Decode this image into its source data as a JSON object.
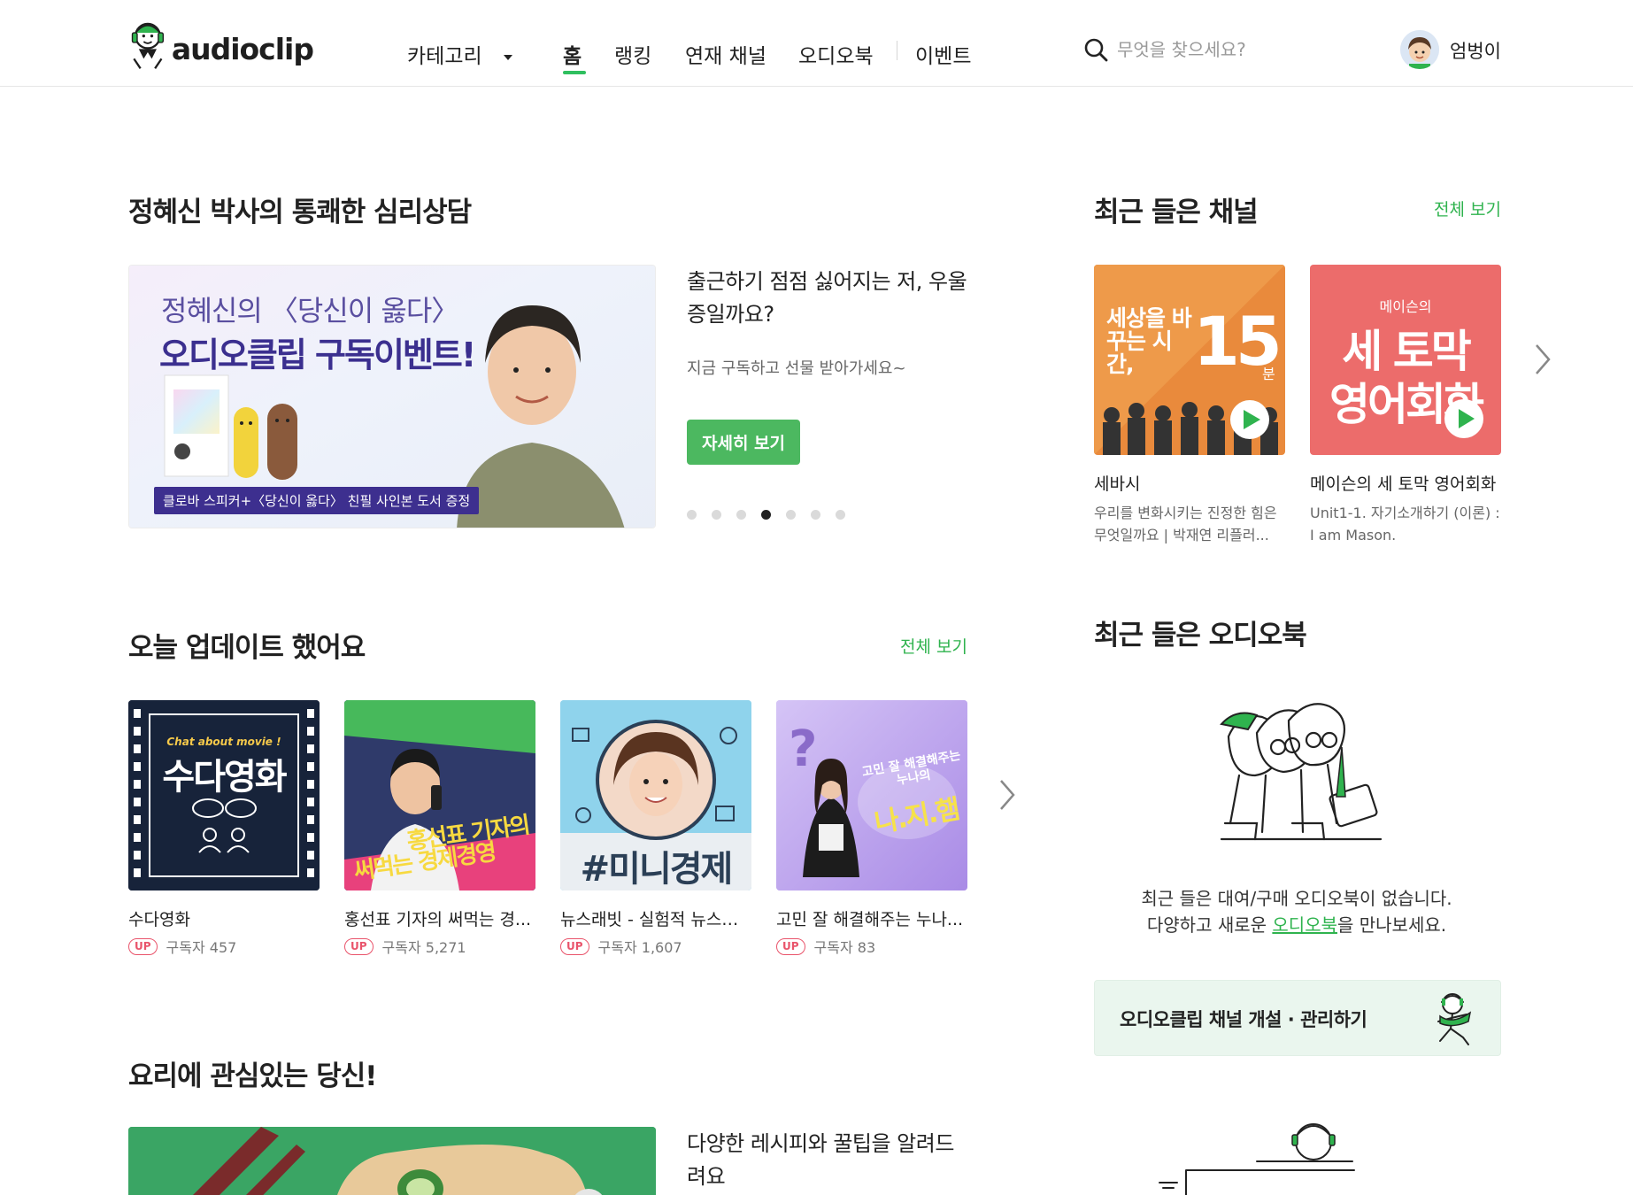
{
  "header": {
    "logo_text": "audioclip",
    "nav": {
      "category": "카테고리",
      "home": "홈",
      "ranking": "랭킹",
      "serial": "연재 채널",
      "audiobook": "오디오북",
      "event": "이벤트"
    },
    "search_placeholder": "무엇을 찾으세요?",
    "username": "엄벙이"
  },
  "feature": {
    "section_title": "정혜신 박사의 통쾌한 심리상담",
    "banner_line1": "정혜신의 〈당신이 옳다〉",
    "banner_line2": "오디오클립 구독이벤트!",
    "banner_caption": "클로바 스피커+〈당신이 옳다〉 친필 사인본 도서 증정",
    "headline": "출근하기 점점 싫어지는 저, 우울증일까요?",
    "sub": "지금 구독하고 선물 받아가세요~",
    "button": "자세히 보기",
    "dots_total": 7,
    "dots_active": 4
  },
  "recent_channels": {
    "title": "최근 들은 채널",
    "view_all": "전체 보기",
    "items": [
      {
        "thumb_text_a": "세상을 바꾸는 시간,",
        "thumb_text_b": "15",
        "thumb_text_c": "분",
        "title": "세바시",
        "desc": "우리를 변화시키는 진정한 힘은 무엇일까요 | 박재연 리플러..."
      },
      {
        "thumb_text_a": "메이슨의",
        "thumb_text_b": "세 토막",
        "thumb_text_c": "영어회화",
        "title": "메이슨의 세 토막 영어회화",
        "desc": "Unit1-1. 자기소개하기 (이론) : I am Mason."
      }
    ]
  },
  "updates": {
    "title": "오늘 업데이트 했어요",
    "view_all": "전체 보기",
    "badge": "UP",
    "items": [
      {
        "title": "수다영화",
        "subscribers": "구독자 457",
        "thumb_small": "Chat about movie !",
        "thumb_big": "수다영화"
      },
      {
        "title": "홍선표 기자의 써먹는 경...",
        "subscribers": "구독자 5,271",
        "thumb_big": "홍선표 기자의",
        "thumb_big2": "써먹는 경제경영"
      },
      {
        "title": "뉴스래빗 - 실험적 뉴스생활",
        "subscribers": "구독자 1,607",
        "thumb_big": "#미니경제"
      },
      {
        "title": "고민 잘 해결해주는 누나...",
        "subscribers": "구독자 83",
        "thumb_small": "고민 잘 해결해주는 누나의",
        "thumb_big": "나.지.햄"
      }
    ]
  },
  "audiobook": {
    "title": "최근 들은 오디오북",
    "empty_line1": "최근 들은 대여/구매 오디오북이 없습니다.",
    "empty_pre": "다양하고 새로운 ",
    "empty_link": "오디오북",
    "empty_post": "을 만나보세요.",
    "channel_btn": "오디오클립 채널 개설 · 관리하기"
  },
  "cooking": {
    "title": "요리에 관심있는 당신!",
    "headline": "다양한 레시피와 꿀팁을 알려드려요"
  },
  "colors": {
    "accent_green": "#2fb34e",
    "button_green": "#4cb860",
    "up_badge": "#e9546b"
  }
}
